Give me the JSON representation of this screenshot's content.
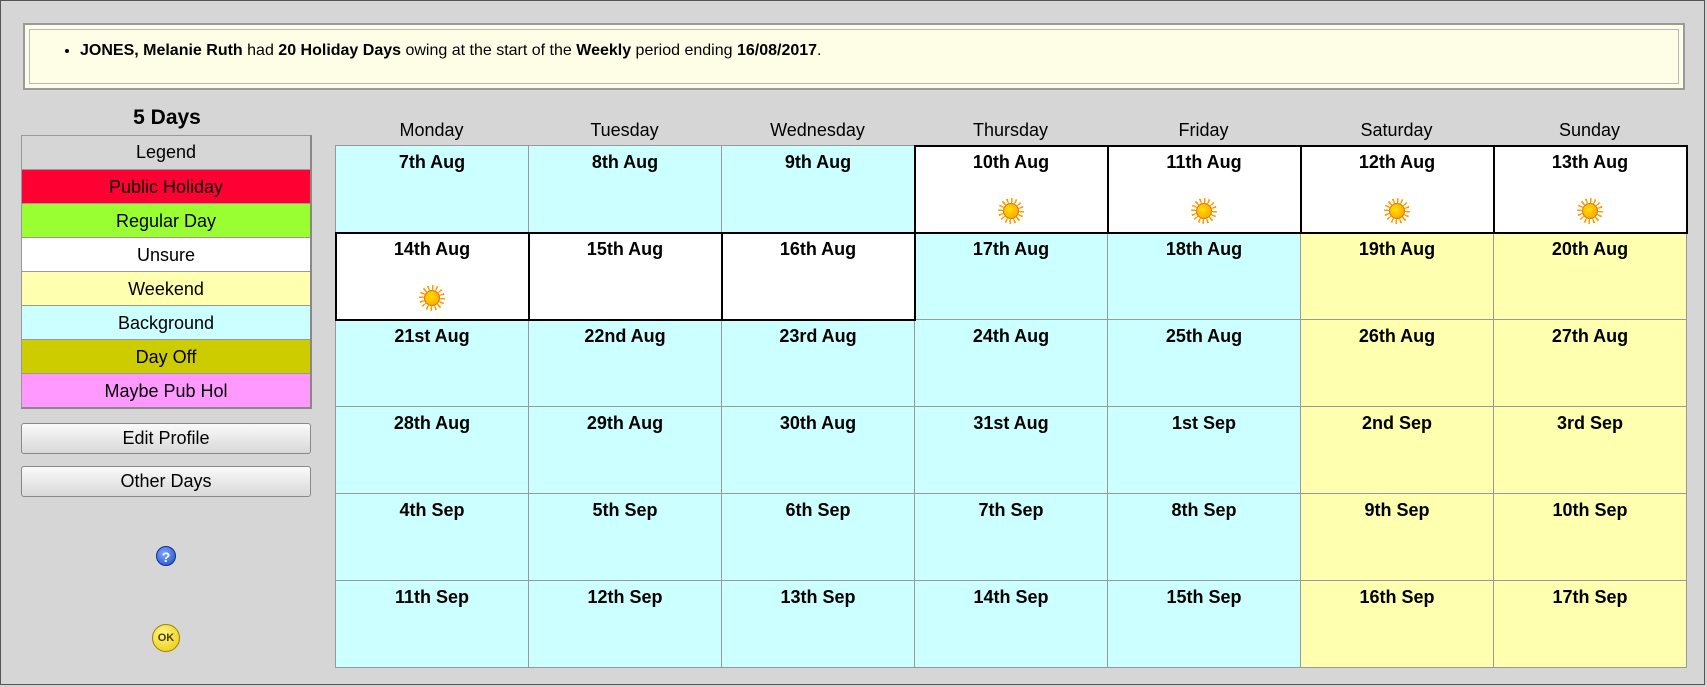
{
  "notice": {
    "name": "JONES, Melanie Ruth",
    "t1": " had ",
    "days": "20 Holiday Days",
    "t2": " owing at the start of the ",
    "period": "Weekly",
    "t3": " period ending ",
    "date": "16/08/2017",
    "t4": "."
  },
  "left": {
    "title": "5 Days",
    "legend_title": "Legend",
    "legend": [
      {
        "label": "Public Holiday",
        "color": "#ff0033"
      },
      {
        "label": "Regular Day",
        "color": "#99ff33"
      },
      {
        "label": "Unsure",
        "color": "#ffffff"
      },
      {
        "label": "Weekend",
        "color": "#ffffb0"
      },
      {
        "label": "Background",
        "color": "#ccffff"
      },
      {
        "label": "Day Off",
        "color": "#cccc00"
      },
      {
        "label": "Maybe Pub Hol",
        "color": "#ff99ff"
      }
    ],
    "edit_profile": "Edit Profile",
    "other_days": "Other Days",
    "help_icon": "?",
    "ok_icon": "OK"
  },
  "calendar": {
    "weekdays": [
      "Monday",
      "Tuesday",
      "Wednesday",
      "Thursday",
      "Friday",
      "Saturday",
      "Sunday"
    ],
    "weeks": [
      [
        {
          "label": "7th Aug",
          "type": "bg",
          "sun": false
        },
        {
          "label": "8th Aug",
          "type": "bg",
          "sun": false
        },
        {
          "label": "9th Aug",
          "type": "bg",
          "sun": false
        },
        {
          "label": "10th Aug",
          "type": "un",
          "sun": true
        },
        {
          "label": "11th Aug",
          "type": "un",
          "sun": true
        },
        {
          "label": "12th Aug",
          "type": "un",
          "sun": true
        },
        {
          "label": "13th Aug",
          "type": "un",
          "sun": true
        }
      ],
      [
        {
          "label": "14th Aug",
          "type": "un",
          "sun": true
        },
        {
          "label": "15th Aug",
          "type": "un",
          "sun": false
        },
        {
          "label": "16th Aug",
          "type": "un",
          "sun": false
        },
        {
          "label": "17th Aug",
          "type": "bg",
          "sun": false
        },
        {
          "label": "18th Aug",
          "type": "bg",
          "sun": false
        },
        {
          "label": "19th Aug",
          "type": "we",
          "sun": false
        },
        {
          "label": "20th Aug",
          "type": "we",
          "sun": false
        }
      ],
      [
        {
          "label": "21st Aug",
          "type": "bg",
          "sun": false
        },
        {
          "label": "22nd Aug",
          "type": "bg",
          "sun": false
        },
        {
          "label": "23rd Aug",
          "type": "bg",
          "sun": false
        },
        {
          "label": "24th Aug",
          "type": "bg",
          "sun": false
        },
        {
          "label": "25th Aug",
          "type": "bg",
          "sun": false
        },
        {
          "label": "26th Aug",
          "type": "we",
          "sun": false
        },
        {
          "label": "27th Aug",
          "type": "we",
          "sun": false
        }
      ],
      [
        {
          "label": "28th Aug",
          "type": "bg",
          "sun": false
        },
        {
          "label": "29th Aug",
          "type": "bg",
          "sun": false
        },
        {
          "label": "30th Aug",
          "type": "bg",
          "sun": false
        },
        {
          "label": "31st Aug",
          "type": "bg",
          "sun": false
        },
        {
          "label": "1st Sep",
          "type": "bg",
          "sun": false
        },
        {
          "label": "2nd Sep",
          "type": "we",
          "sun": false
        },
        {
          "label": "3rd Sep",
          "type": "we",
          "sun": false
        }
      ],
      [
        {
          "label": "4th Sep",
          "type": "bg",
          "sun": false
        },
        {
          "label": "5th Sep",
          "type": "bg",
          "sun": false
        },
        {
          "label": "6th Sep",
          "type": "bg",
          "sun": false
        },
        {
          "label": "7th Sep",
          "type": "bg",
          "sun": false
        },
        {
          "label": "8th Sep",
          "type": "bg",
          "sun": false
        },
        {
          "label": "9th Sep",
          "type": "we",
          "sun": false
        },
        {
          "label": "10th Sep",
          "type": "we",
          "sun": false
        }
      ],
      [
        {
          "label": "11th Sep",
          "type": "bg",
          "sun": false
        },
        {
          "label": "12th Sep",
          "type": "bg",
          "sun": false
        },
        {
          "label": "13th Sep",
          "type": "bg",
          "sun": false
        },
        {
          "label": "14th Sep",
          "type": "bg",
          "sun": false
        },
        {
          "label": "15th Sep",
          "type": "bg",
          "sun": false
        },
        {
          "label": "16th Sep",
          "type": "we",
          "sun": false
        },
        {
          "label": "17th Sep",
          "type": "we",
          "sun": false
        }
      ]
    ]
  }
}
